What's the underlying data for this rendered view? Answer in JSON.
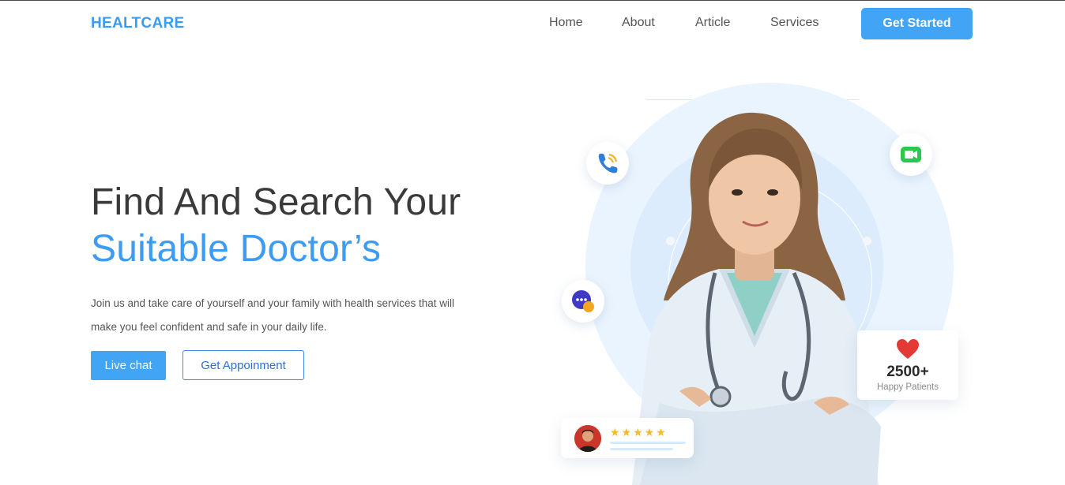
{
  "brand": "HEALTCARE",
  "nav": [
    "Home",
    "About",
    "Article",
    "Services"
  ],
  "header_cta": "Get Started",
  "hero": {
    "title_line1": "Find And Search Your",
    "title_line2": "Suitable Doctor’s",
    "description": "Join us and take care of yourself and your family with health services that will make you feel confident and safe in your daily life.",
    "primary_button": "Live chat",
    "secondary_button": "Get Appoinment"
  },
  "stats": {
    "value": "2500+",
    "label": "Happy Patients"
  },
  "review": {
    "rating": 5,
    "stars": "★★★★★"
  },
  "colors": {
    "accent": "#42a4f5",
    "heading": "#3a3a3a",
    "circle": "#eaf4fe"
  },
  "icons": [
    "phone-call-icon",
    "video-call-icon",
    "chat-bubble-icon",
    "heart-icon",
    "star-icon"
  ]
}
